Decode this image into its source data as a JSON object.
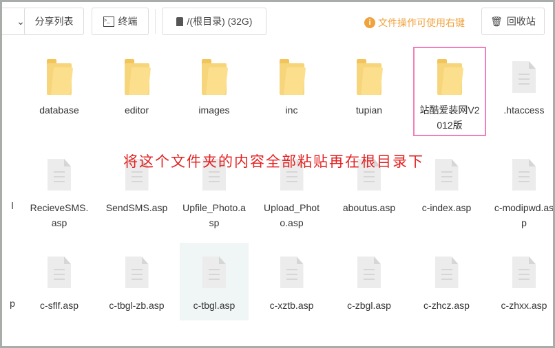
{
  "toolbar": {
    "share_list": "分享列表",
    "terminal": "终端",
    "disk": "/(根目录) (32G)",
    "tip": "文件操作可使用右键",
    "recycle": "回收站"
  },
  "note": "将这个文件夹的内容全部粘贴再在根目录下",
  "rows": [
    [
      {
        "name": "database",
        "type": "folder"
      },
      {
        "name": "editor",
        "type": "folder"
      },
      {
        "name": "images",
        "type": "folder"
      },
      {
        "name": "inc",
        "type": "folder"
      },
      {
        "name": "tupian",
        "type": "folder"
      },
      {
        "name": "站酷爱装网V2012版",
        "type": "folder",
        "selected": true
      },
      {
        "name": ".htaccess",
        "type": "file"
      }
    ],
    [
      {
        "name": "RecieveSMS.asp",
        "type": "file"
      },
      {
        "name": "SendSMS.asp",
        "type": "file"
      },
      {
        "name": "Upfile_Photo.asp",
        "type": "file"
      },
      {
        "name": "Upload_Photo.asp",
        "type": "file"
      },
      {
        "name": "aboutus.asp",
        "type": "file"
      },
      {
        "name": "c-index.asp",
        "type": "file"
      },
      {
        "name": "c-modipwd.asp",
        "type": "file"
      }
    ],
    [
      {
        "name": "c-sflf.asp",
        "type": "file"
      },
      {
        "name": "c-tbgl-zb.asp",
        "type": "file"
      },
      {
        "name": "c-tbgl.asp",
        "type": "file",
        "hover": true
      },
      {
        "name": "c-xztb.asp",
        "type": "file"
      },
      {
        "name": "c-zbgl.asp",
        "type": "file"
      },
      {
        "name": "c-zhcz.asp",
        "type": "file"
      },
      {
        "name": "c-zhxx.asp",
        "type": "file"
      }
    ]
  ],
  "partial": {
    "row2": "l",
    "row3": "p"
  }
}
